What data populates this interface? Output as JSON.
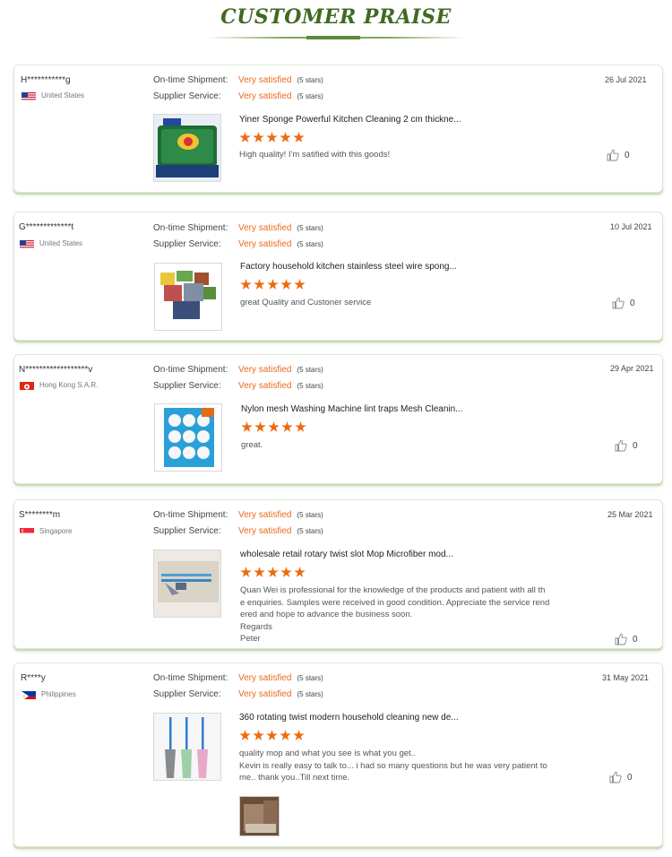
{
  "page": {
    "title": "CUSTOMER PRAISE"
  },
  "labels": {
    "shipment": "On-time Shipment:",
    "service": "Supplier Service:"
  },
  "reviews": [
    {
      "buyer": "H***********g",
      "country": "United States",
      "flag": "us-flag",
      "shipment_rating": "Very satisfied",
      "shipment_stars": "(5 stars)",
      "service_rating": "Very satisfied",
      "service_stars": "(5 stars)",
      "date": "26 Jul 2021",
      "product_title": "Yiner Sponge Powerful Kitchen Cleaning 2 cm thickne...",
      "rating": 5,
      "text": [
        "High quality! I'm satified with this goods!"
      ],
      "likes": "0"
    },
    {
      "buyer": "G*************t",
      "country": "United States",
      "flag": "us-flag",
      "shipment_rating": "Very satisfied",
      "shipment_stars": "(5 stars)",
      "service_rating": "Very satisfied",
      "service_stars": "(5 stars)",
      "date": "10 Jul 2021",
      "product_title": "Factory household kitchen stainless steel wire spong...",
      "rating": 5,
      "text": [
        "great Quality and Custoner service"
      ],
      "likes": "0"
    },
    {
      "buyer": "N******************v",
      "country": "Hong Kong S.A.R.",
      "flag": "hk-flag",
      "shipment_rating": "Very satisfied",
      "shipment_stars": "(5 stars)",
      "service_rating": "Very satisfied",
      "service_stars": "(5 stars)",
      "date": "29 Apr 2021",
      "product_title": "Nylon mesh Washing Machine lint traps Mesh Cleanin...",
      "rating": 5,
      "text": [
        "great."
      ],
      "likes": "0"
    },
    {
      "buyer": "S********m",
      "country": "Singapore",
      "flag": "sg-flag",
      "shipment_rating": "Very satisfied",
      "shipment_stars": "(5 stars)",
      "service_rating": "Very satisfied",
      "service_stars": "(5 stars)",
      "date": "25 Mar 2021",
      "product_title": "wholesale retail rotary twist slot Mop Microfiber mod...",
      "rating": 5,
      "text": [
        "Quan Wei is professional for the knowledge of the products and patient with all th",
        "e enquiries. Samples were received in good condition. Appreciate the service rend",
        "ered and hope to advance the business soon.",
        "Regards",
        "Peter"
      ],
      "likes": "0"
    },
    {
      "buyer": "R****y",
      "country": "Philippines",
      "flag": "ph-flag",
      "shipment_rating": "Very satisfied",
      "shipment_stars": "(5 stars)",
      "service_rating": "Very satisfied",
      "service_stars": "(5 stars)",
      "date": "31 May 2021",
      "product_title": "360 rotating twist modern household cleaning new de...",
      "rating": 5,
      "text": [
        "quality mop and what you see is what you get..",
        "Kevin is really easy to talk to... i had so many questions but he was very patient to",
        "me.. thank you..Till next time."
      ],
      "likes": "0"
    }
  ]
}
